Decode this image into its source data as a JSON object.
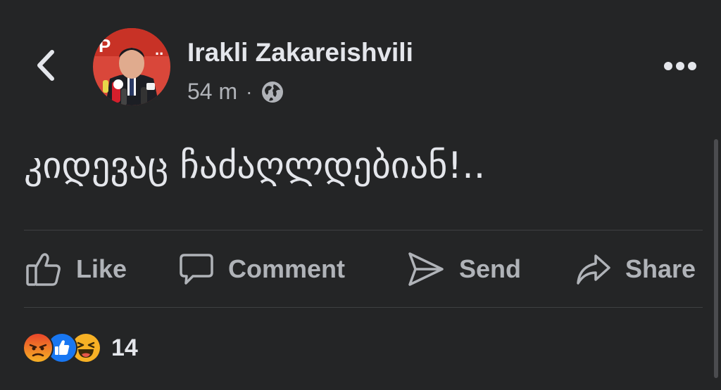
{
  "post": {
    "author": "Irakli Zakareishvili",
    "time": "54 m",
    "separator": "·",
    "privacy_icon": "globe-icon",
    "text": "კიდევაც ჩაძაღლდებიან!.."
  },
  "actions": {
    "like": "Like",
    "comment": "Comment",
    "send": "Send",
    "share": "Share"
  },
  "reactions": {
    "types": [
      "angry-icon",
      "like-icon",
      "haha-icon"
    ],
    "count": "14"
  },
  "colors": {
    "background": "#242526",
    "primary_text": "#e4e6eb",
    "secondary_text": "#b0b3b8",
    "divider": "#3e4042",
    "like_blue": "#1877f2",
    "reaction_orange": "#f7b125",
    "angry_red": "#e9710f"
  }
}
